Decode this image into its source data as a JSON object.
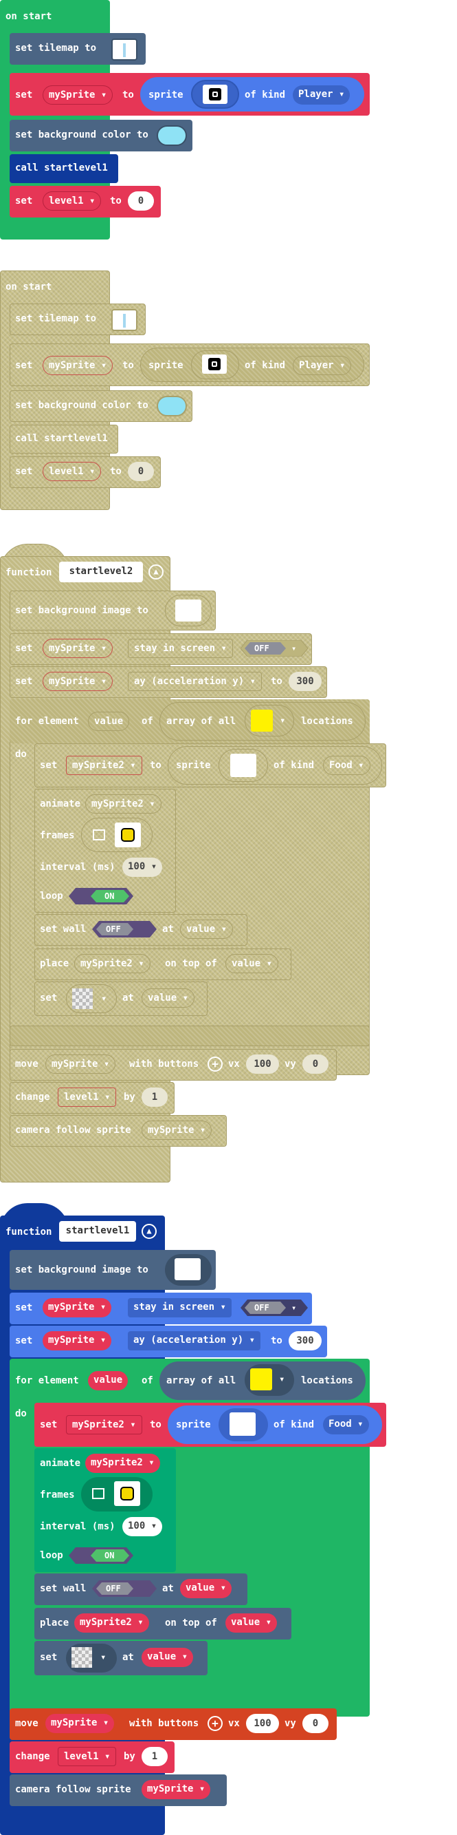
{
  "colors": {
    "loops_green": "#1fb665",
    "scene_slate": "#4b6584",
    "sprites_red": "#e63656",
    "sprites_blue": "#4b7bec",
    "functions_navy": "#0f3a9c",
    "controller_orange": "#d54322",
    "animation_green": "#03aa74",
    "disabled_olive": "#c8c08a"
  },
  "on_start": {
    "hat_label": "on start",
    "set_tilemap": "set tilemap to",
    "set": "set",
    "to": "to",
    "sprite_var": "mySprite",
    "sprite": "sprite",
    "of_kind": "of kind",
    "kind_player": "Player",
    "set_bg_color": "set background color to",
    "call": "call startlevel1",
    "level_var": "level1",
    "zero": "0"
  },
  "fn": {
    "function": "function",
    "name_2": "startlevel2",
    "name_1": "startlevel1",
    "set_bg_image": "set background image to",
    "set": "set",
    "sprite_var": "mySprite",
    "stay_in_screen": "stay in screen",
    "off": "OFF",
    "on": "ON",
    "ay": "ay (acceleration y)",
    "to": "to",
    "ay_value": "300",
    "for_element": "for element",
    "value": "value",
    "of": "of",
    "array_of_all": "array of all",
    "locations": "locations",
    "do": "do",
    "sprite2_var": "mySprite2",
    "sprite": "sprite",
    "of_kind": "of kind",
    "kind_food": "Food",
    "animate": "animate",
    "frames": "frames",
    "interval": "interval (ms)",
    "interval_value": "100",
    "loop": "loop",
    "set_wall": "set wall",
    "at": "at",
    "place": "place",
    "on_top_of": "on top of",
    "move": "move",
    "with_buttons": "with buttons",
    "vx": "vx",
    "vx_value": "100",
    "vy": "vy",
    "vy_value": "0",
    "change": "change",
    "level_var": "level1",
    "by": "by",
    "by_value": "1",
    "camera_follow": "camera follow sprite"
  }
}
